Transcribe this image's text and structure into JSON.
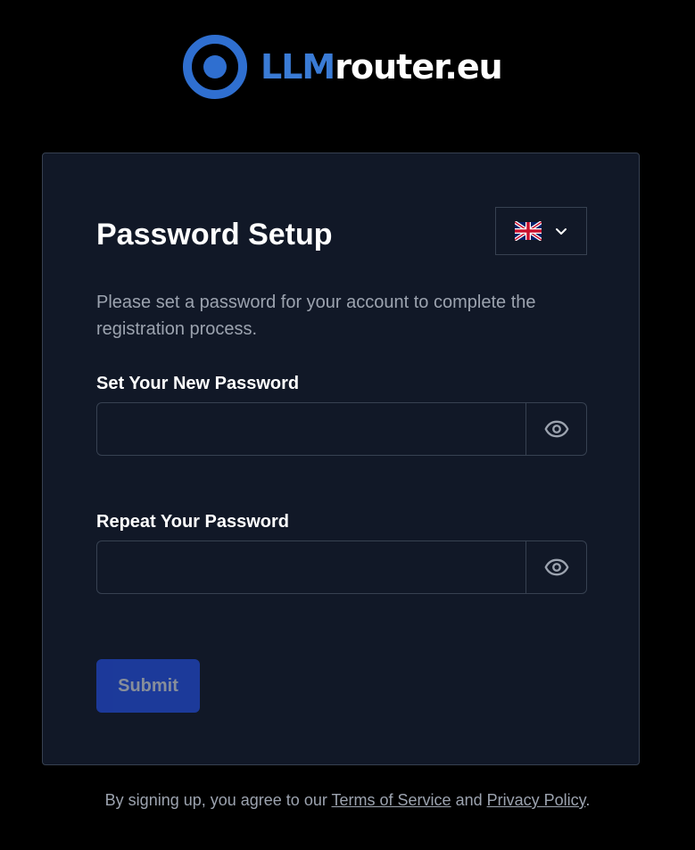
{
  "brand": {
    "logo_part_a": "LLM",
    "logo_part_b": "router.eu",
    "accent_color": "#3a7bd5",
    "logo_icon": "llmrouter-logo-icon"
  },
  "card": {
    "title": "Password Setup",
    "language_selector": {
      "selected": "English",
      "flag_icon": "uk-flag-icon",
      "chevron_icon": "chevron-down-icon"
    },
    "description": "Please set a password for your account to complete the registration process.",
    "fields": [
      {
        "label": "Set Your New Password",
        "value": "",
        "placeholder": "",
        "toggle_icon": "eye-icon"
      },
      {
        "label": "Repeat Your Password",
        "value": "",
        "placeholder": "",
        "toggle_icon": "eye-icon"
      }
    ],
    "submit_label": "Submit"
  },
  "footer": {
    "prefix": "By signing up, you agree to our ",
    "terms_label": "Terms of Service",
    "conjunction": " and ",
    "privacy_label": "Privacy Policy",
    "suffix": "."
  },
  "colors": {
    "page_background": "#000000",
    "card_background": "#111827",
    "border": "#374151",
    "muted_text": "#9ca3af",
    "submit_background": "#1e40af"
  }
}
